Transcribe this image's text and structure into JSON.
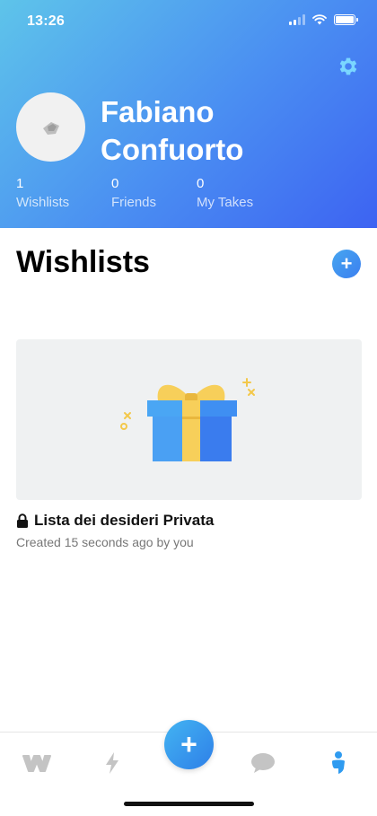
{
  "status_bar": {
    "time": "13:26"
  },
  "profile": {
    "name_line1": "Fabiano",
    "name_line2": "Confuorto",
    "stats": [
      {
        "value": "1",
        "label": "Wishlists"
      },
      {
        "value": "0",
        "label": "Friends"
      },
      {
        "value": "0",
        "label": "My Takes"
      }
    ]
  },
  "wishlists_section": {
    "title": "Wishlists",
    "add_label": "+"
  },
  "wishlist_card": {
    "title": "Lista dei desideri Privata",
    "meta": "Created 15 seconds ago by you",
    "icon": "lock-icon"
  },
  "tabbar": {
    "fab_label": "+",
    "items": [
      {
        "icon": "wishes-logo-icon",
        "active": false
      },
      {
        "icon": "lightning-icon",
        "active": false
      },
      {
        "icon": "chat-bubble-icon",
        "active": false
      },
      {
        "icon": "profile-icon",
        "active": true
      }
    ]
  },
  "colors": {
    "accent": "#3b82f0",
    "gradient_start": "#5ec4ea",
    "gradient_end": "#3d63f2",
    "inactive_icon": "#c4c4c4"
  }
}
